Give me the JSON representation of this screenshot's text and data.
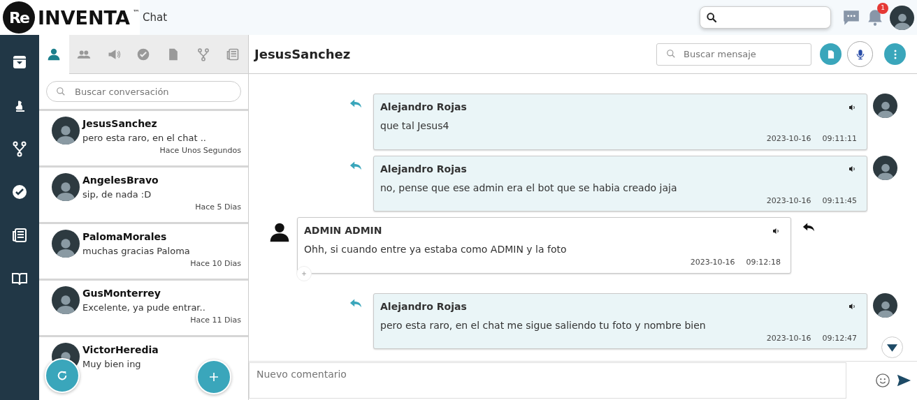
{
  "header": {
    "logo_mark": "Re",
    "logo_name": "INVENTA",
    "trademark": "™",
    "product": "Chat",
    "notifications": "1"
  },
  "sidebar": {
    "items": [
      {
        "selected": false
      },
      {
        "selected": false
      },
      {
        "selected": false
      },
      {
        "selected": false
      },
      {
        "selected": false
      },
      {
        "selected": false
      }
    ]
  },
  "tabs": [
    {
      "selected": true
    },
    {
      "selected": false
    },
    {
      "selected": false
    },
    {
      "selected": false
    },
    {
      "selected": false
    },
    {
      "selected": false
    },
    {
      "selected": false
    }
  ],
  "conversation_search": {
    "placeholder": "Buscar conversación"
  },
  "conversations": [
    {
      "name": "JesusSanchez",
      "preview": "pero esta raro, en el chat ..",
      "time": "Hace Unos Segundos"
    },
    {
      "name": "AngelesBravo",
      "preview": "sip, de nada :D",
      "time": "Hace 5 Dias"
    },
    {
      "name": "PalomaMorales",
      "preview": "muchas gracias Paloma",
      "time": "Hace 10 Dias"
    },
    {
      "name": "GusMonterrey",
      "preview": "Excelente, ya pude entrar..",
      "time": "Hace 11 Dias"
    },
    {
      "name": "VictorHeredia",
      "preview": "Muy bien ing"
    }
  ],
  "chat": {
    "title": "JesusSanchez",
    "search_placeholder": "Buscar mensaje",
    "messages": [
      {
        "kind": "outgoing",
        "sender": "Alejandro Rojas",
        "text": "que tal Jesus4",
        "date": "2023-10-16",
        "time": "09:11:11"
      },
      {
        "kind": "outgoing",
        "sender": "Alejandro Rojas",
        "text": "no, pense que ese admin era el bot que se habia creado jaja",
        "date": "2023-10-16",
        "time": "09:11:45"
      },
      {
        "kind": "incoming",
        "sender": "ADMIN ADMIN",
        "text": "Ohh, si cuando entre ya estaba como ADMIN y la foto",
        "date": "2023-10-16",
        "time": "09:12:18"
      },
      {
        "kind": "outgoing",
        "sender": "Alejandro Rojas",
        "text": "pero esta raro, en el chat me sigue saliendo tu foto y nombre bien",
        "date": "2023-10-16",
        "time": "09:12:47"
      }
    ],
    "composer_placeholder": "Nuevo comentario"
  }
}
